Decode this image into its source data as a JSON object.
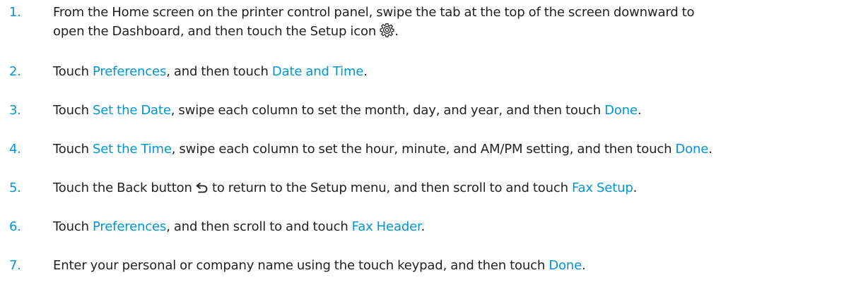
{
  "steps": [
    {
      "num": "1.",
      "t1": "From the Home screen on the printer control panel, swipe the tab at the top of the screen downward to",
      "t2": "open the Dashboard, and then touch the Setup icon",
      "t3": ".",
      "icon": "gear-icon"
    },
    {
      "num": "2.",
      "t1": "Touch ",
      "u1": "Preferences",
      "t2": ", and then touch ",
      "u2": "Date and Time",
      "t3": "."
    },
    {
      "num": "3.",
      "t1": "Touch ",
      "u1": "Set the Date",
      "t2": ", swipe each column to set the month, day, and year, and then touch ",
      "u2": "Done",
      "t3": "."
    },
    {
      "num": "4.",
      "t1": "Touch ",
      "u1": "Set the Time",
      "t2": ", swipe each column to set the hour, minute, and AM/PM setting, and then touch ",
      "u2": "Done",
      "t3": "."
    },
    {
      "num": "5.",
      "t1": "Touch the Back button ",
      "t2": "to return to the Setup menu, and then scroll to and touch ",
      "u1": "Fax Setup",
      "t3": ".",
      "icon": "back-arrow-icon"
    },
    {
      "num": "6.",
      "t1": "Touch ",
      "u1": "Preferences",
      "t2": ", and then scroll to and touch ",
      "u2": "Fax Header",
      "t3": "."
    },
    {
      "num": "7.",
      "t1": "Enter your personal or company name using the touch keypad, and then touch ",
      "u1": "Done",
      "t2": "."
    }
  ],
  "colors": {
    "accent": "#0096d6",
    "text": "#231f20"
  }
}
